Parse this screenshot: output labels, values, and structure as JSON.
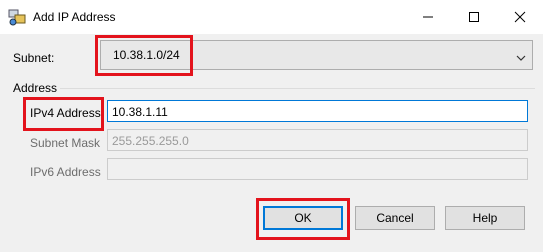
{
  "window": {
    "title": "Add IP Address",
    "icons": [
      "app-icon",
      "minimize-icon",
      "maximize-icon",
      "close-icon"
    ]
  },
  "subnet": {
    "label": "Subnet:",
    "value": "10.38.1.0/24",
    "icon": "chevron-down-icon"
  },
  "address_group": {
    "label": "Address"
  },
  "ipv4": {
    "label": "IPv4 Address:",
    "value": "10.38.1.11"
  },
  "subnet_mask": {
    "label": "Subnet Mask",
    "value": "255.255.255.0"
  },
  "ipv6": {
    "label": "IPv6 Address",
    "value": ""
  },
  "buttons": {
    "ok": "OK",
    "cancel": "Cancel",
    "help": "Help"
  },
  "colors": {
    "highlight": "#e3131c",
    "focus": "#0078d7",
    "background": "#f0f0f0"
  }
}
